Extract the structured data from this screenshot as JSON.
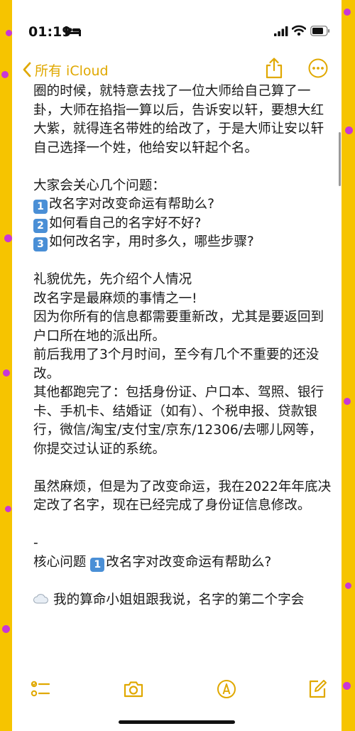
{
  "status_bar": {
    "time": "01:19"
  },
  "nav": {
    "back_label": "所有 iCloud"
  },
  "note": {
    "lines_block1": "圈的时候，就特意去找了一位大师给自己算了一卦，大师在掐指一算以后，告诉安以轩，要想大红大紫，就得连名带姓的给改了，于是大师让安以轩自己选择一个姓，他给安以轩起个名。",
    "questions_title": "大家会关心几个问题：",
    "questions": [
      {
        "num": "1",
        "text": "改名字对改变命运有帮助么?"
      },
      {
        "num": "2",
        "text": "如何看自己的名字好不好?"
      },
      {
        "num": "3",
        "text": "如何改名字，用时多久，哪些步骤?"
      }
    ],
    "intro": "礼貌优先，先介绍个人情况",
    "p1": "改名字是最麻烦的事情之一!",
    "p2": "因为你所有的信息都需要重新改，尤其是要返回到户口所在地的派出所。",
    "p3": "前后我用了3个月时间，至今有几个不重要的还没改。",
    "p4": "其他都跑完了：包括身份证、户口本、驾照、银行卡、手机卡、结婚证（如有）、个税申报、贷款银行，微信/淘宝/支付宝/京东/12306/去哪儿网等，你提交过认证的系统。",
    "p5": "虽然麻烦，但是为了改变命运，我在2022年年底决定改了名字，现在已经完成了身份证信息修改。",
    "dash": "-",
    "core_prefix": "核心问题 ",
    "core_num": "1",
    "core_text": "改名字对改变命运有帮助么?",
    "last": "我的算命小姐姐跟我说，名字的第二个字会"
  },
  "colors": {
    "background": "#f6c400",
    "dots": "#c837d6",
    "accent": "#e0a800",
    "keycap": "#4a8fd6"
  },
  "icons": {
    "status": [
      "bed-icon",
      "cellular-signal-icon",
      "wifi-icon",
      "battery-icon"
    ],
    "nav": [
      "chevron-left-icon",
      "share-icon",
      "more-icon"
    ],
    "toolbar": [
      "checklist-icon",
      "camera-icon",
      "markup-pen-icon",
      "compose-icon"
    ]
  }
}
